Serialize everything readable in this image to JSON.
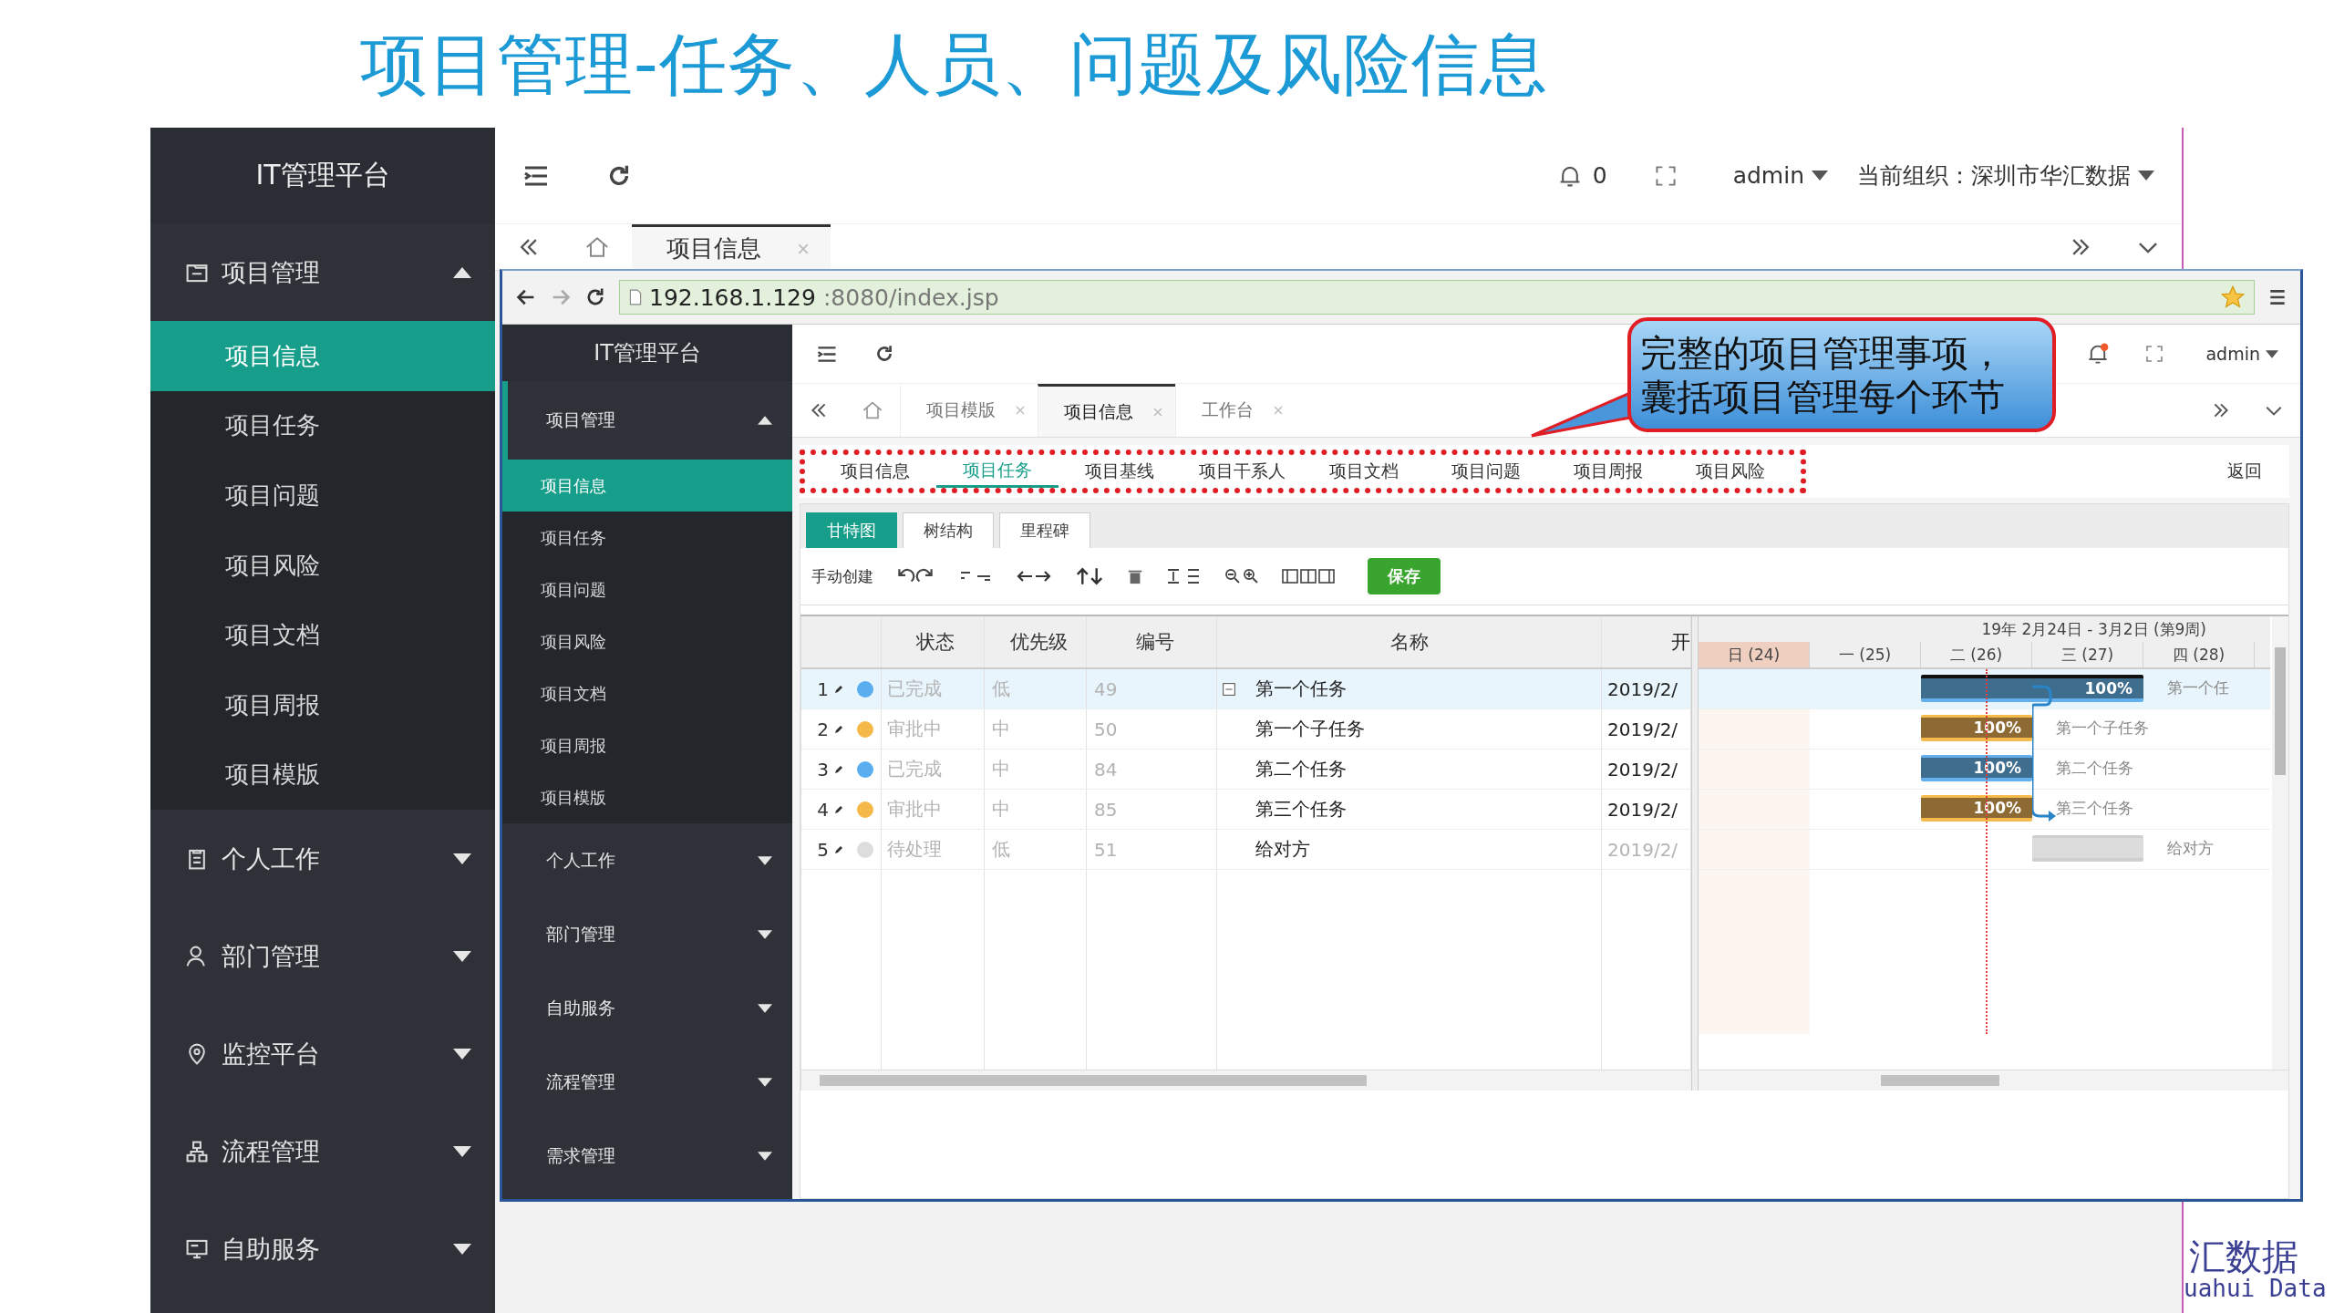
{
  "slide_title": "项目管理-任务、人员、问题及风险信息",
  "outer": {
    "sidebar": {
      "title": "IT管理平台",
      "items": [
        {
          "label": "项目管理",
          "kind": "project",
          "expanded": true,
          "children": [
            {
              "label": "项目信息",
              "selected": true
            },
            {
              "label": "项目任务",
              "selected": false
            },
            {
              "label": "项目问题",
              "selected": false
            },
            {
              "label": "项目风险",
              "selected": false
            },
            {
              "label": "项目文档",
              "selected": false
            },
            {
              "label": "项目周报",
              "selected": false
            },
            {
              "label": "项目模版",
              "selected": false
            }
          ]
        },
        {
          "label": "个人工作",
          "kind": "work",
          "expanded": false
        },
        {
          "label": "部门管理",
          "kind": "department",
          "expanded": false
        },
        {
          "label": "监控平台",
          "kind": "monitor",
          "expanded": false
        },
        {
          "label": "流程管理",
          "kind": "process",
          "expanded": false
        },
        {
          "label": "自助服务",
          "kind": "service",
          "expanded": false
        }
      ]
    },
    "header": {
      "notifications": "0",
      "user": "admin",
      "org": "当前组织：深圳市华汇数据"
    },
    "tabs": [
      {
        "label": "项目信息",
        "selected": true
      }
    ]
  },
  "browser": {
    "url_host": "192.168.1.129",
    "url_path": ":8080/index.jsp"
  },
  "inner": {
    "sidebar": {
      "title": "IT管理平台",
      "items": [
        {
          "label": "项目管理",
          "expanded": true,
          "children": [
            {
              "label": "项目信息",
              "selected": true
            },
            {
              "label": "项目任务",
              "selected": false
            },
            {
              "label": "项目问题",
              "selected": false
            },
            {
              "label": "项目风险",
              "selected": false
            },
            {
              "label": "项目文档",
              "selected": false
            },
            {
              "label": "项目周报",
              "selected": false
            },
            {
              "label": "项目模版",
              "selected": false
            }
          ]
        },
        {
          "label": "个人工作",
          "expanded": false
        },
        {
          "label": "部门管理",
          "expanded": false
        },
        {
          "label": "自助服务",
          "expanded": false
        },
        {
          "label": "流程管理",
          "expanded": false
        },
        {
          "label": "需求管理",
          "expanded": false
        }
      ]
    },
    "header": {
      "user": "admin",
      "alert": true
    },
    "tabs": [
      {
        "label": "项目模版",
        "selected": false
      },
      {
        "label": "项目信息",
        "selected": true
      },
      {
        "label": "工作台",
        "selected": false
      }
    ],
    "subnav": [
      {
        "label": "项目信息",
        "selected": false
      },
      {
        "label": "项目任务",
        "selected": true
      },
      {
        "label": "项目基线",
        "selected": false
      },
      {
        "label": "项目干系人",
        "selected": false
      },
      {
        "label": "项目文档",
        "selected": false
      },
      {
        "label": "项目问题",
        "selected": false
      },
      {
        "label": "项目周报",
        "selected": false
      },
      {
        "label": "项目风险",
        "selected": false
      }
    ],
    "back": "返回",
    "view_tabs": [
      {
        "label": "甘特图",
        "selected": true
      },
      {
        "label": "树结构",
        "selected": false
      },
      {
        "label": "里程碑",
        "selected": false
      }
    ],
    "toolbar": {
      "create_label": "手动创建",
      "save": "保存"
    },
    "table": {
      "columns": [
        "状态",
        "优先级",
        "编号",
        "名称",
        "开"
      ],
      "rows": [
        {
          "num": "1",
          "status": "已完成",
          "color": "#5aaef0",
          "priority": "低",
          "code": "49",
          "name": "第一个任务",
          "start": "2019/2/",
          "start_dimmed": false,
          "selected": true,
          "expanded": true,
          "children": [
            {
              "num": "2",
              "status": "审批中",
              "color": "#f5b94a",
              "priority": "中",
              "code": "50",
              "name": "第一个子任务",
              "start": "2019/2/",
              "start_dimmed": false,
              "selected": false
            },
            {
              "num": "3",
              "status": "已完成",
              "color": "#5aaef0",
              "priority": "中",
              "code": "84",
              "name": "第二个任务",
              "start": "2019/2/",
              "start_dimmed": false,
              "selected": false
            },
            {
              "num": "4",
              "status": "审批中",
              "color": "#f5b94a",
              "priority": "中",
              "code": "85",
              "name": "第三个任务",
              "start": "2019/2/",
              "start_dimmed": false,
              "selected": false
            },
            {
              "num": "5",
              "status": "待处理",
              "color": "#dddddd",
              "priority": "低",
              "code": "51",
              "name": "给对方",
              "start": "2019/2/",
              "start_dimmed": true,
              "selected": false
            }
          ]
        }
      ]
    },
    "gantt": {
      "week": "19年 2月24日 - 3月2日 (第9周)",
      "days": [
        {
          "label": "日 (24)",
          "weekend": true
        },
        {
          "label": "一 (25)",
          "weekend": false
        },
        {
          "label": "二 (26)",
          "weekend": false
        },
        {
          "label": "三 (27)",
          "weekend": false
        },
        {
          "label": "四 (28)",
          "weekend": false
        }
      ],
      "bars": [
        {
          "kind": "summary",
          "days_on": [
            false,
            false,
            true,
            true,
            false
          ],
          "progress": "100%",
          "label": "第一个任"
        },
        {
          "kind": "approval",
          "days_on": [
            false,
            false,
            true,
            false,
            false
          ],
          "progress": "100%",
          "label": "第一个子任务"
        },
        {
          "kind": "done",
          "days_on": [
            false,
            false,
            true,
            false,
            false
          ],
          "progress": "100%",
          "label": "第二个任务"
        },
        {
          "kind": "approval",
          "days_on": [
            false,
            false,
            true,
            false,
            false
          ],
          "progress": "100%",
          "label": "第三个任务"
        },
        {
          "kind": "pending",
          "days_on": [
            false,
            false,
            false,
            true,
            false
          ],
          "label": "给对方"
        }
      ]
    }
  },
  "callout": {
    "lines": [
      "完整的项目管理事项，",
      "囊括项目管理每个环节"
    ]
  },
  "logo": {
    "cn": "汇数据",
    "en": "uahui Data"
  }
}
